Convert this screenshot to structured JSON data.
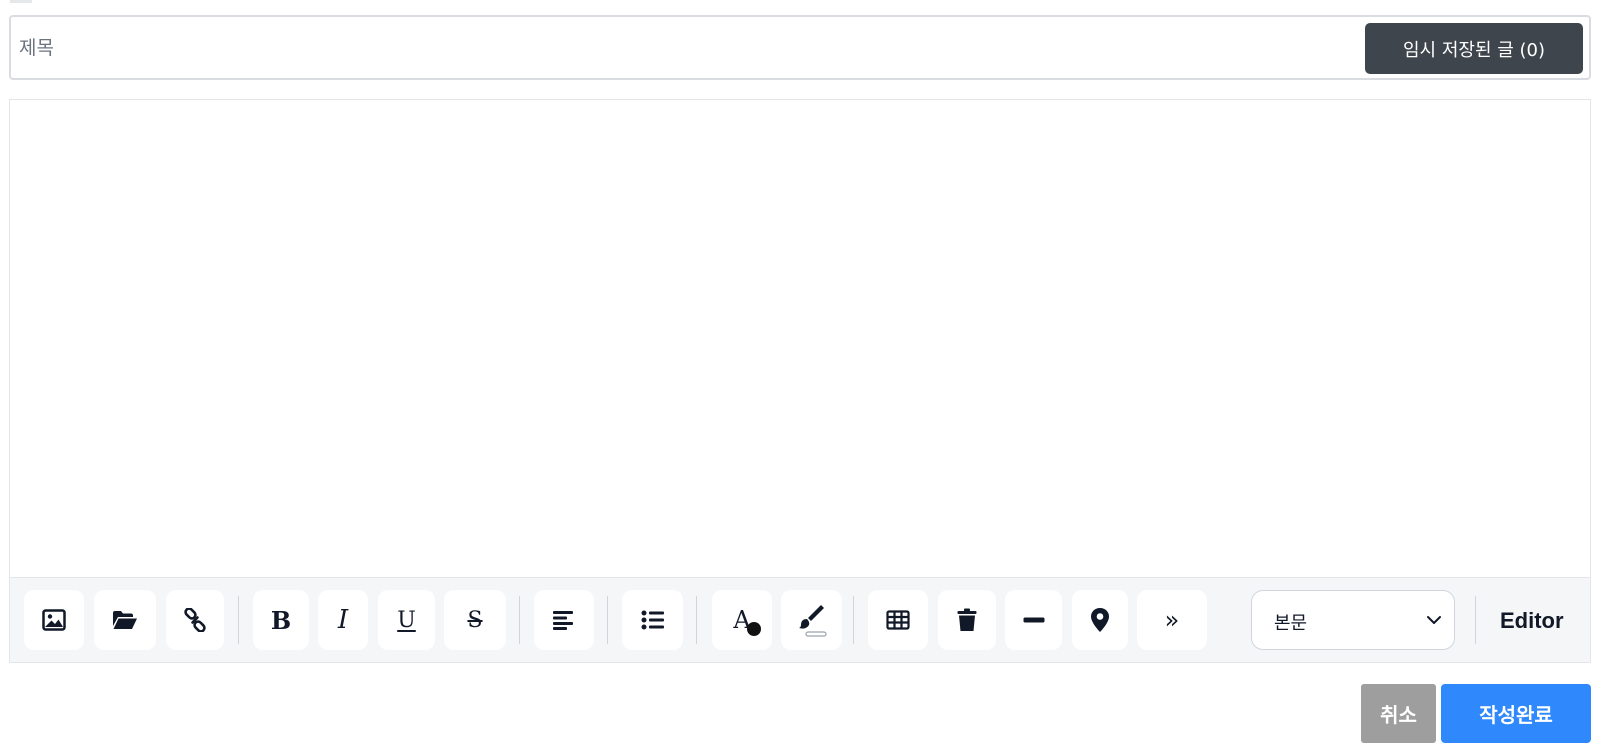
{
  "title_field": {
    "placeholder": "제목",
    "value": ""
  },
  "drafts_button": {
    "label": "임시 저장된 글 (0)"
  },
  "toolbar": {
    "items": [
      {
        "name": "insert-image",
        "icon": "image-icon"
      },
      {
        "name": "attach-file",
        "icon": "folder-open-icon"
      },
      {
        "name": "insert-link",
        "icon": "link-icon"
      },
      {
        "name": "bold",
        "icon": "bold-icon",
        "glyph": "B"
      },
      {
        "name": "italic",
        "icon": "italic-icon",
        "glyph": "I"
      },
      {
        "name": "underline",
        "icon": "underline-icon",
        "glyph": "U"
      },
      {
        "name": "strikethrough",
        "icon": "strikethrough-icon",
        "glyph": "S"
      },
      {
        "name": "align-left",
        "icon": "align-left-icon"
      },
      {
        "name": "bullet-list",
        "icon": "list-icon"
      },
      {
        "name": "text-color",
        "icon": "text-color-icon",
        "glyph": "A"
      },
      {
        "name": "highlight-color",
        "icon": "paint-brush-icon"
      },
      {
        "name": "insert-table",
        "icon": "table-icon"
      },
      {
        "name": "delete",
        "icon": "trash-icon"
      },
      {
        "name": "horizontal-rule",
        "icon": "minus-icon"
      },
      {
        "name": "insert-map",
        "icon": "map-pin-icon"
      },
      {
        "name": "more-tools",
        "icon": "double-chevron-right-icon",
        "glyph": "»"
      }
    ],
    "paragraph_style": {
      "selected": "본문"
    },
    "mode_label": "Editor"
  },
  "actions": {
    "cancel_label": "취소",
    "submit_label": "작성완료"
  },
  "colors": {
    "drafts_button_bg": "#3f454c",
    "submit_bg": "#2f89fc",
    "cancel_bg": "#9e9e9e",
    "toolbar_bg": "#f5f6f7",
    "text_color_swatch": "#111111"
  }
}
